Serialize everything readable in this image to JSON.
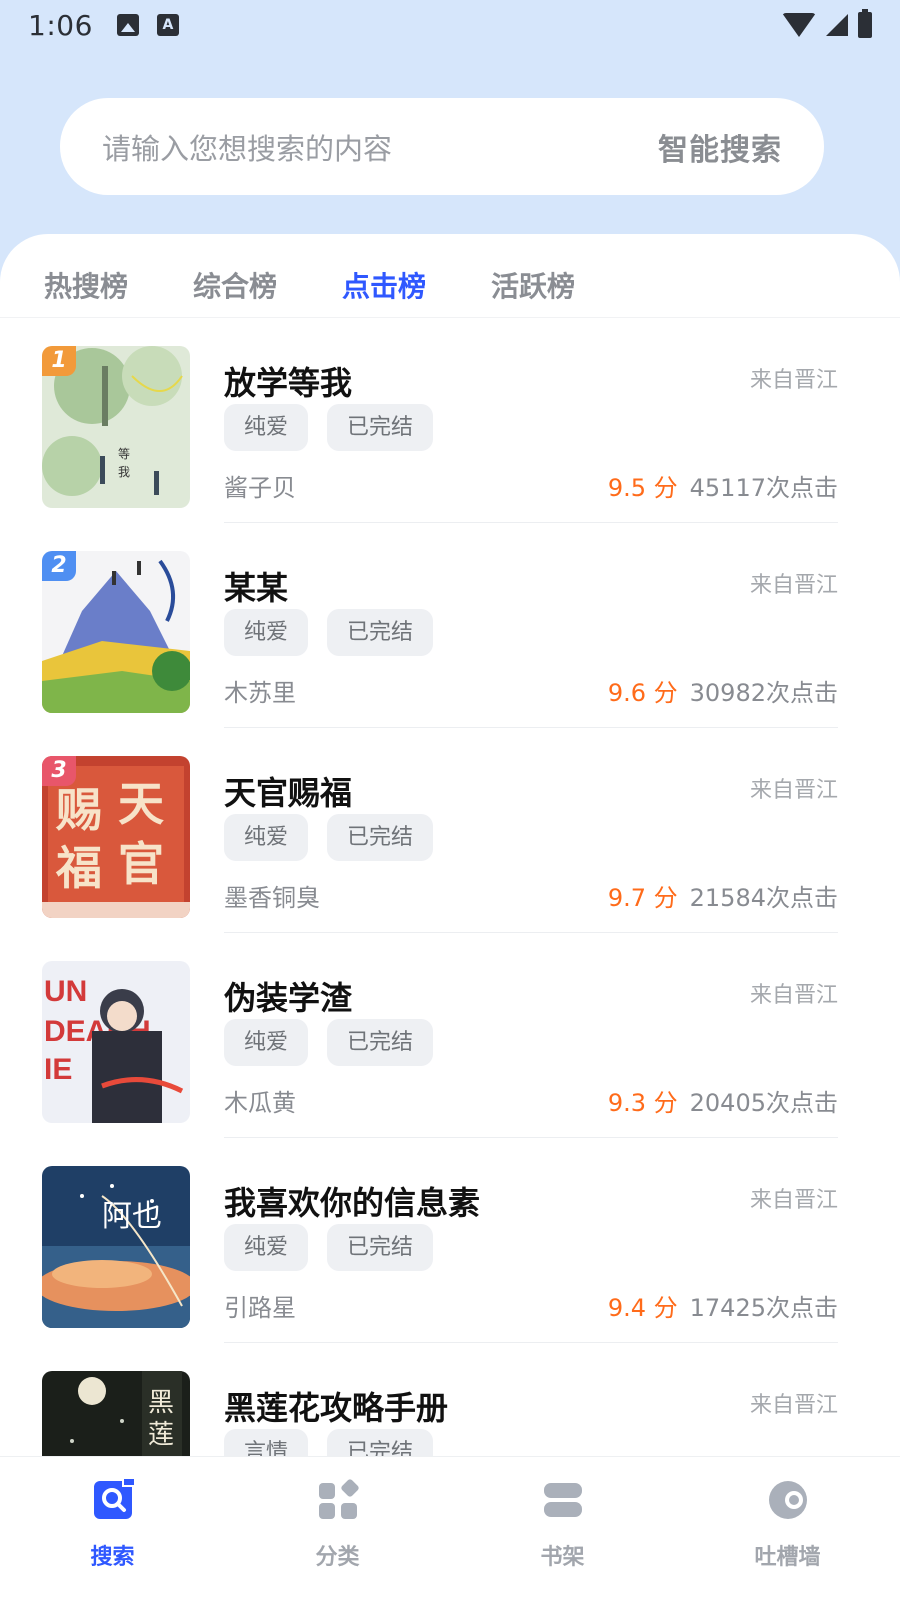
{
  "status_bar": {
    "time": "1:06"
  },
  "search": {
    "placeholder": "请输入您想搜索的内容",
    "button": "智能搜索"
  },
  "tabs": [
    {
      "label": "热搜榜"
    },
    {
      "label": "综合榜"
    },
    {
      "label": "点击榜",
      "active": true
    },
    {
      "label": "活跃榜"
    }
  ],
  "books": [
    {
      "rank": "1",
      "title": "放学等我",
      "source": "来自晋江",
      "tags": [
        "纯爱",
        "已完结"
      ],
      "author": "酱子贝",
      "score": "9.5 分",
      "clicks": "45117次点击"
    },
    {
      "rank": "2",
      "title": "某某",
      "source": "来自晋江",
      "tags": [
        "纯爱",
        "已完结"
      ],
      "author": "木苏里",
      "score": "9.6 分",
      "clicks": "30982次点击"
    },
    {
      "rank": "3",
      "title": "天官赐福",
      "source": "来自晋江",
      "tags": [
        "纯爱",
        "已完结"
      ],
      "author": "墨香铜臭",
      "score": "9.7 分",
      "clicks": "21584次点击"
    },
    {
      "rank": "",
      "title": "伪装学渣",
      "source": "来自晋江",
      "tags": [
        "纯爱",
        "已完结"
      ],
      "author": "木瓜黄",
      "score": "9.3 分",
      "clicks": "20405次点击"
    },
    {
      "rank": "",
      "title": "我喜欢你的信息素",
      "source": "来自晋江",
      "tags": [
        "纯爱",
        "已完结"
      ],
      "author": "引路星",
      "score": "9.4 分",
      "clicks": "17425次点击"
    },
    {
      "rank": "",
      "title": "黑莲花攻略手册",
      "source": "来自晋江",
      "tags": [
        "言情",
        "已完结"
      ],
      "author": "",
      "score": "",
      "clicks": ""
    }
  ],
  "bottom_nav": [
    {
      "label": "搜索",
      "icon": "search-icon",
      "active": true
    },
    {
      "label": "分类",
      "icon": "category-icon"
    },
    {
      "label": "书架",
      "icon": "bookshelf-icon"
    },
    {
      "label": "吐槽墙",
      "icon": "chat-wall-icon"
    }
  ],
  "colors": {
    "accent": "#2f58ff",
    "score": "#ff6b1a",
    "header_bg": "#d6e6fb"
  }
}
